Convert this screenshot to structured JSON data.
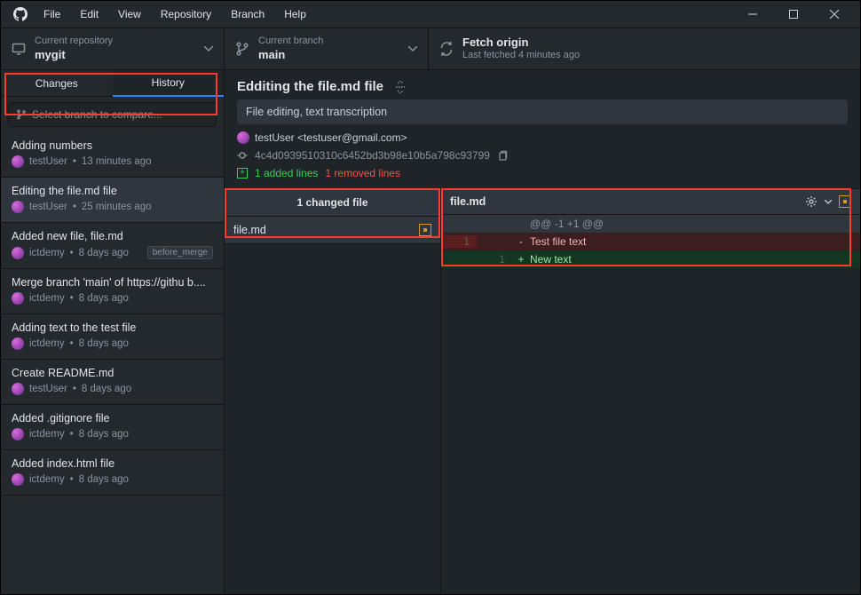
{
  "menu": {
    "items": [
      "File",
      "Edit",
      "View",
      "Repository",
      "Branch",
      "Help"
    ]
  },
  "toolbar": {
    "repo": {
      "label": "Current repository",
      "value": "mygit"
    },
    "branch": {
      "label": "Current branch",
      "value": "main"
    },
    "fetch": {
      "label": "Fetch origin",
      "value": "Last fetched 4 minutes ago"
    }
  },
  "tabs": {
    "changes": "Changes",
    "history": "History"
  },
  "compare_placeholder": "Select branch to compare...",
  "commits": [
    {
      "title": "Adding numbers",
      "author": "testUser",
      "time": "13 minutes ago",
      "tag": ""
    },
    {
      "title": "Editing the file.md file",
      "author": "testUser",
      "time": "25 minutes ago",
      "tag": ""
    },
    {
      "title": "Added new file, file.md",
      "author": "ictdemy",
      "time": "8 days ago",
      "tag": "before_merge"
    },
    {
      "title": "Merge branch 'main' of https://githu b....",
      "author": "ictdemy",
      "time": "8 days ago",
      "tag": ""
    },
    {
      "title": "Adding text to the test file",
      "author": "ictdemy",
      "time": "8 days ago",
      "tag": ""
    },
    {
      "title": "Create README.md",
      "author": "testUser",
      "time": "8 days ago",
      "tag": ""
    },
    {
      "title": "Added .gitignore file",
      "author": "ictdemy",
      "time": "8 days ago",
      "tag": ""
    },
    {
      "title": "Added index.html file",
      "author": "ictdemy",
      "time": "8 days ago",
      "tag": ""
    }
  ],
  "detail": {
    "title": "Edditing the file.md file",
    "desc": "File editing, text transcription",
    "author": "testUser",
    "email": "testuser@gmail.com",
    "sha": "4c4d0939510310c6452bd3b98e10b5a798c93799",
    "added": "1 added lines",
    "removed": "1 removed lines",
    "changed_files_label": "1 changed file",
    "file": "file.md"
  },
  "diff": {
    "file": "file.md",
    "hunk": "@@ -1 +1 @@",
    "del_line_no": "1",
    "del_text": "Test file text",
    "add_line_no": "1",
    "add_text": "New text"
  }
}
